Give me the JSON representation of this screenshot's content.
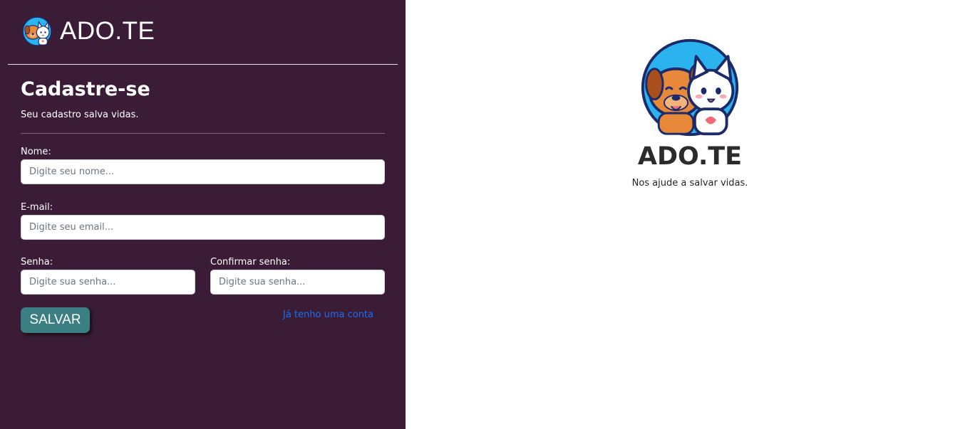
{
  "brand": {
    "name": "ADO.TE",
    "logo_icon": "dog-cat-logo-icon"
  },
  "form": {
    "title": "Cadastre-se",
    "subtitle": "Seu cadastro salva vidas.",
    "name_label": "Nome:",
    "name_placeholder": "Digite seu nome...",
    "email_label": "E-mail:",
    "email_placeholder": "Digite seu email...",
    "password_label": "Senha:",
    "password_placeholder": "Digite sua senha...",
    "confirm_label": "Confirmar senha:",
    "confirm_placeholder": "Digite sua senha...",
    "save_label": "SALVAR",
    "login_link": "Já tenho uma conta"
  },
  "hero": {
    "title": "ADO.TE",
    "subtitle": "Nos ajude a salvar vidas."
  },
  "colors": {
    "sidebar_bg": "#3a1c36",
    "button_bg": "#3b7f83",
    "link": "#1a6ef5"
  }
}
